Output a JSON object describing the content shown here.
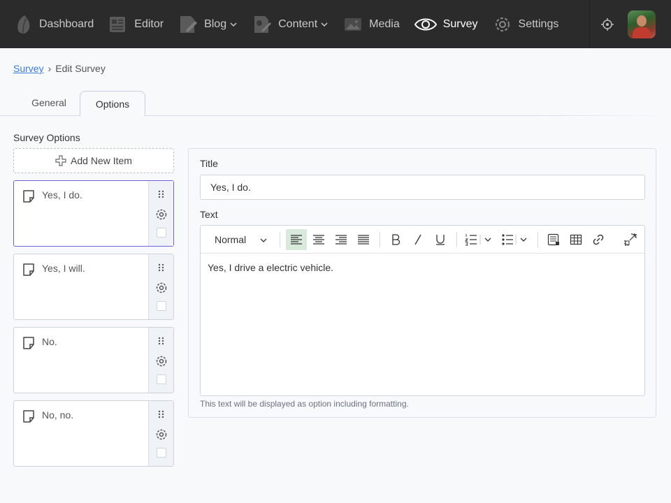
{
  "nav": {
    "items": [
      {
        "label": "Dashboard",
        "icon": "leaf-icon"
      },
      {
        "label": "Editor",
        "icon": "newspaper-icon"
      },
      {
        "label": "Blog",
        "icon": "document-edit-icon"
      },
      {
        "label": "Content",
        "icon": "content-edit-icon"
      },
      {
        "label": "Media",
        "icon": "image-icon"
      },
      {
        "label": "Survey",
        "icon": "eye-icon",
        "active": true
      },
      {
        "label": "Settings",
        "icon": "gear-icon"
      }
    ]
  },
  "breadcrumb": {
    "parent": "Survey",
    "separator": "›",
    "current": "Edit Survey"
  },
  "tabs": [
    {
      "label": "General"
    },
    {
      "label": "Options",
      "active": true
    }
  ],
  "options": {
    "title": "Survey Options",
    "add_label": "Add New Item",
    "items": [
      {
        "label": "Yes, I do.",
        "selected": true
      },
      {
        "label": "Yes, I will."
      },
      {
        "label": "No."
      },
      {
        "label": "No, no."
      }
    ]
  },
  "editor": {
    "title_label": "Title",
    "title_value": "Yes, I do.",
    "text_label": "Text",
    "heading_value": "Normal",
    "content": "Yes, I drive a electric vehicle.",
    "help": "This text will be displayed as option including formatting."
  },
  "colors": {
    "topbar": "#2b2b2b",
    "selected_border": "#6b63d9",
    "active_align": "#d9eadc",
    "link": "#3a7bd5"
  }
}
